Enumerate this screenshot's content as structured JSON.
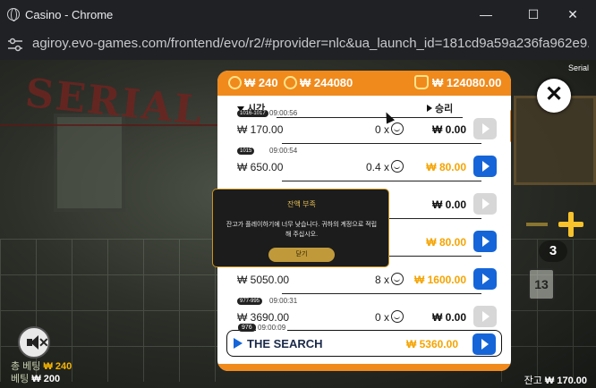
{
  "window": {
    "title": "Casino - Chrome",
    "minimize_label": "—",
    "maximize_label": "☐",
    "close_label": "✕"
  },
  "browser": {
    "url": "agiroy.evo-games.com/frontend/evo/r2/#provider=nlc&ua_launch_id=181cd9a59a236fa962e9..."
  },
  "game": {
    "art_title": "SERIAL",
    "top_right_tag": "Serial",
    "close_label": "✕",
    "counter": "3",
    "locker_number": "13"
  },
  "panel": {
    "header": {
      "bet_amount": "₩ 240",
      "balance_amount": "₩ 244080",
      "bonus_amount": "₩ 124080.00"
    },
    "columns": {
      "time": "시간",
      "win": "승리"
    },
    "rows": [
      {
        "badge": "1016-1017",
        "time": "09:00:56",
        "bet": "₩ 170.00",
        "mult": "0 x",
        "win": "₩ 0.00",
        "win_style": "plain",
        "play_active": false
      },
      {
        "badge": "1015",
        "time": "09:00:54",
        "bet": "₩ 650.00",
        "mult": "0.4 x",
        "win": "₩ 80.00",
        "win_style": "gold",
        "play_active": true
      },
      {
        "badge": "",
        "time": "",
        "bet": "",
        "mult": "",
        "win": "₩ 0.00",
        "win_style": "plain",
        "play_active": false
      },
      {
        "badge": "",
        "time": "",
        "bet": "",
        "mult": "",
        "win": "₩ 80.00",
        "win_style": "gold",
        "play_active": true
      },
      {
        "badge": "",
        "time": "",
        "bet": "₩ 5050.00",
        "mult": "8 x",
        "win": "₩ 1600.00",
        "win_style": "gold",
        "play_active": true
      },
      {
        "badge": "977-995",
        "time": "09:00:31",
        "bet": "₩ 3690.00",
        "mult": "0 x",
        "win": "₩ 0.00",
        "win_style": "plain",
        "play_active": false
      }
    ],
    "search_row": {
      "badge": "976",
      "time": "09:00:09",
      "name": "THE SEARCH",
      "win": "₩ 5360.00"
    }
  },
  "dialog": {
    "title": "잔액 부족",
    "message": "잔고가 플레이하기에 너무 낮습니다. 귀하의 계정으로 적립해 주십시오.",
    "button": "닫기"
  },
  "footer": {
    "total_bet_label": "총 베팅",
    "total_bet_value": "₩ 240",
    "bet_label": "베팅",
    "bet_value": "₩ 200",
    "balance_label": "잔고",
    "balance_value": "₩ 170.00"
  },
  "colors": {
    "accent_orange": "#f08a1c",
    "gold": "#f5a400",
    "play_blue": "#1565d8",
    "dialog_border": "#c89420"
  }
}
